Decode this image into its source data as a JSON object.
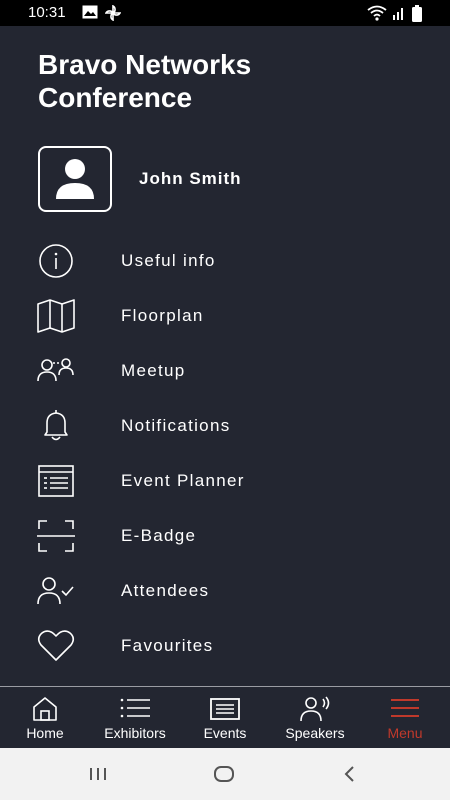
{
  "status_bar": {
    "time": "10:31",
    "left_icons": [
      "image-icon",
      "pinwheel-icon"
    ],
    "right_icons": [
      "wifi-icon",
      "signal-icon",
      "battery-icon"
    ]
  },
  "app": {
    "title_line1": "Bravo Networks",
    "title_line2": "Conference"
  },
  "profile": {
    "name": "John Smith"
  },
  "menu": {
    "items": [
      {
        "label": "Useful info",
        "icon": "info-icon"
      },
      {
        "label": "Floorplan",
        "icon": "map-icon"
      },
      {
        "label": "Meetup",
        "icon": "meetup-icon"
      },
      {
        "label": "Notifications",
        "icon": "bell-icon"
      },
      {
        "label": "Event Planner",
        "icon": "planner-icon"
      },
      {
        "label": "E-Badge",
        "icon": "badge-scan-icon"
      },
      {
        "label": "Attendees",
        "icon": "attendees-icon"
      },
      {
        "label": "Favourites",
        "icon": "heart-icon"
      }
    ]
  },
  "tab_bar": {
    "tabs": [
      {
        "label": "Home",
        "icon": "home-icon"
      },
      {
        "label": "Exhibitors",
        "icon": "list-icon"
      },
      {
        "label": "Events",
        "icon": "events-icon"
      },
      {
        "label": "Speakers",
        "icon": "speaker-icon"
      },
      {
        "label": "Menu",
        "icon": "hamburger-icon",
        "active": true
      }
    ],
    "active_color": "#c0392b"
  },
  "colors": {
    "background": "#232631",
    "text": "#ffffff",
    "accent": "#c0392b"
  },
  "nav_bar": {
    "buttons": [
      "recents-icon",
      "home-nav-icon",
      "back-icon"
    ]
  }
}
